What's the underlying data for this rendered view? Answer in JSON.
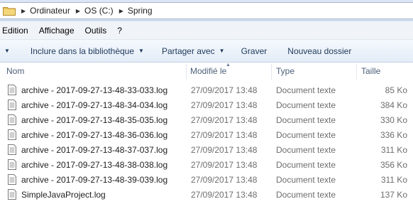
{
  "breadcrumb": [
    "Ordinateur",
    "OS (C:)",
    "Spring"
  ],
  "menu": [
    "Edition",
    "Affichage",
    "Outils",
    "?"
  ],
  "commands": {
    "organize_arrow": "▼",
    "include_label": "Inclure dans la bibliothèque",
    "share_label": "Partager avec",
    "burn_label": "Graver",
    "new_folder_label": "Nouveau dossier"
  },
  "columns": {
    "name": "Nom",
    "modified": "Modifié le",
    "type": "Type",
    "size": "Taille"
  },
  "files": [
    {
      "name": "archive - 2017-09-27-13-48-33-033.log",
      "date": "27/09/2017 13:48",
      "type": "Document texte",
      "size": "85 Ko"
    },
    {
      "name": "archive - 2017-09-27-13-48-34-034.log",
      "date": "27/09/2017 13:48",
      "type": "Document texte",
      "size": "384 Ko"
    },
    {
      "name": "archive - 2017-09-27-13-48-35-035.log",
      "date": "27/09/2017 13:48",
      "type": "Document texte",
      "size": "330 Ko"
    },
    {
      "name": "archive - 2017-09-27-13-48-36-036.log",
      "date": "27/09/2017 13:48",
      "type": "Document texte",
      "size": "336 Ko"
    },
    {
      "name": "archive - 2017-09-27-13-48-37-037.log",
      "date": "27/09/2017 13:48",
      "type": "Document texte",
      "size": "311 Ko"
    },
    {
      "name": "archive - 2017-09-27-13-48-38-038.log",
      "date": "27/09/2017 13:48",
      "type": "Document texte",
      "size": "356 Ko"
    },
    {
      "name": "archive - 2017-09-27-13-48-39-039.log",
      "date": "27/09/2017 13:48",
      "type": "Document texte",
      "size": "311 Ko"
    },
    {
      "name": "SimpleJavaProject.log",
      "date": "27/09/2017 13:48",
      "type": "Document texte",
      "size": "137 Ko"
    }
  ]
}
